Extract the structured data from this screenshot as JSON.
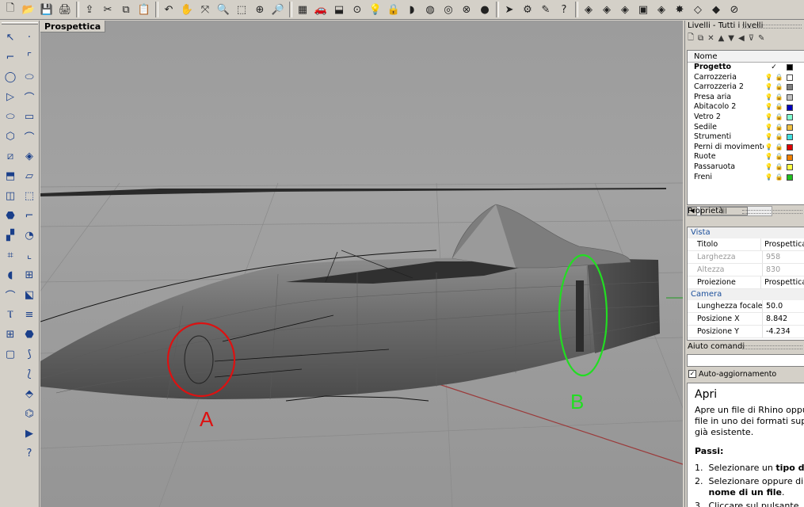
{
  "toolbar": {
    "icons": [
      "new-file",
      "open-folder",
      "save",
      "print",
      "export",
      "cut",
      "copy",
      "paste",
      "undo",
      "pan-hand",
      "rotate-view",
      "zoom",
      "zoom-window",
      "zoom-extents",
      "zoom-selected",
      "grid-layout",
      "car-shade",
      "shade-toggle",
      "point-osnap",
      "light-bulb",
      "lock",
      "render",
      "color-wheel",
      "sphere-render",
      "camera-toggle",
      "globe",
      "arrow-flag",
      "gear-settings",
      "properties",
      "help",
      "osnap-tool",
      "osnap-tool",
      "osnap-tool",
      "cube-tool",
      "osnap-tool",
      "star-tool",
      "ruler-tool",
      "diamond-tool",
      "check-tool"
    ],
    "glyphs": [
      "🗋",
      "📂",
      "💾",
      "🖨",
      "⇪",
      "✂",
      "⧉",
      "📋",
      "↶",
      "✋",
      "⤧",
      "🔍",
      "⬚",
      "⊕",
      "🔎",
      "▦",
      "🚗",
      "⬓",
      "⊙",
      "💡",
      "🔒",
      "◗",
      "◍",
      "◎",
      "⊗",
      "●",
      "➤",
      "⚙",
      "✎",
      "?",
      "◈",
      "◈",
      "◈",
      "▣",
      "◈",
      "✸",
      "◇",
      "◆",
      "⊘"
    ]
  },
  "left_toolbar": {
    "col1": [
      "↖",
      "⌐",
      "◯",
      "▷",
      "⬭",
      "⬡",
      "⧄",
      "⬒",
      "◫",
      "⬣",
      "▞",
      "⌗",
      "◖",
      "⌒",
      "Ⲧ",
      "⊞",
      "▢"
    ],
    "col2": [
      "·",
      "⌜",
      "⬭",
      "⌒",
      "▭",
      "⌒",
      "◈",
      "▱",
      "⬚",
      "⌐",
      "◔",
      "⌞",
      "⊞",
      "⬕",
      "≡",
      "⬣",
      "⟆",
      "⟅",
      "⬘",
      "⌬",
      "▶",
      "?"
    ]
  },
  "viewport": {
    "tab_label": "Prospettica",
    "label_a": "A",
    "label_b": "B",
    "circle_a_color": "#dd1111",
    "circle_b_color": "#22dd22"
  },
  "layers": {
    "panel_title": "Livelli - Tutti i livelli",
    "column_name": "Nome",
    "rows": [
      {
        "name": "Progetto",
        "current": "✓",
        "color": "#000000",
        "bold": true
      },
      {
        "name": "Carrozzeria",
        "color": "#ffffff"
      },
      {
        "name": "Carrozzeria 2",
        "color": "#7f7f7f"
      },
      {
        "name": "Presa aria",
        "color": "#c0c0c0"
      },
      {
        "name": "Abitacolo 2",
        "color": "#0000c0"
      },
      {
        "name": "Vetro 2",
        "color": "#80ffd0"
      },
      {
        "name": "Sedile",
        "color": "#f0c040"
      },
      {
        "name": "Strumenti",
        "color": "#40e0e0"
      },
      {
        "name": "Perni di movimento",
        "color": "#e00000"
      },
      {
        "name": "Ruote",
        "color": "#f08000"
      },
      {
        "name": "Passaruota",
        "color": "#ffff40"
      },
      {
        "name": "Freni",
        "color": "#20c020"
      }
    ]
  },
  "properties": {
    "panel_title": "Proprietà",
    "section_view": "Vista",
    "rows_view": [
      {
        "key": "Titolo",
        "value": "Prospettica"
      },
      {
        "key": "Larghezza",
        "value": "958",
        "disabled": true
      },
      {
        "key": "Altezza",
        "value": "830",
        "disabled": true
      },
      {
        "key": "Proiezione",
        "value": "Prospettica"
      }
    ],
    "section_camera": "Camera",
    "rows_camera": [
      {
        "key": "Lunghezza focale",
        "value": "50.0"
      },
      {
        "key": "Posizione X",
        "value": "8.842"
      },
      {
        "key": "Posizione Y",
        "value": "-4.234"
      }
    ]
  },
  "help": {
    "panel_title": "Aiuto comandi",
    "auto_update": "Auto-aggiornamento",
    "title": "Apri",
    "description_1": "Apre un file di Rhino oppu",
    "description_2": "file in uno dei formati sup",
    "description_3": "già esistente.",
    "steps_heading": "Passi:",
    "step1_num": "1.",
    "step1_a": "Selezionare un ",
    "step1_b": "tipo d",
    "step2_num": "2.",
    "step2_a": "Selezionare oppure di",
    "step2_b": "nome di un file",
    "step2_c": ".",
    "step3_num": "3.",
    "step3_a": "Cliccare sul pulsante"
  }
}
